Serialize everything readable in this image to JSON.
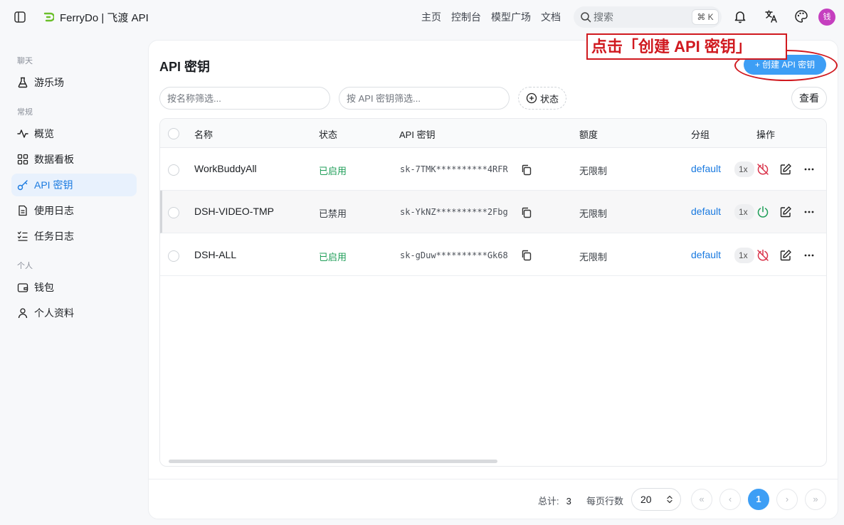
{
  "app": {
    "title": "FerryDo | 飞渡 API"
  },
  "nav": {
    "items": [
      "主页",
      "控制台",
      "模型广场",
      "文档"
    ]
  },
  "search": {
    "placeholder": "搜索",
    "shortcut": "⌘ K"
  },
  "user": {
    "avatar_text": "钱",
    "avatar_color": "#c53fbf"
  },
  "sidebar": {
    "sections": [
      {
        "label": "聊天",
        "items": [
          {
            "label": "游乐场",
            "icon": "flask-icon"
          }
        ]
      },
      {
        "label": "常规",
        "items": [
          {
            "label": "概览",
            "icon": "activity-icon"
          },
          {
            "label": "数据看板",
            "icon": "dashboard-icon"
          },
          {
            "label": "API 密钥",
            "icon": "key-icon",
            "active": true
          },
          {
            "label": "使用日志",
            "icon": "document-icon"
          },
          {
            "label": "任务日志",
            "icon": "list-icon"
          }
        ]
      },
      {
        "label": "个人",
        "items": [
          {
            "label": "钱包",
            "icon": "wallet-icon"
          },
          {
            "label": "个人资料",
            "icon": "user-icon"
          }
        ]
      }
    ]
  },
  "page": {
    "title": "API 密钥",
    "create_button": "+ 创建 API 密钥",
    "annotation": "点击「创建 API 密钥」",
    "filters": {
      "name_placeholder": "按名称筛选...",
      "key_placeholder": "按 API 密钥筛选...",
      "status_button": "状态",
      "view_button": "查看"
    }
  },
  "table": {
    "columns": [
      "名称",
      "状态",
      "API 密钥",
      "额度",
      "分组",
      "操作"
    ],
    "rows": [
      {
        "name": "WorkBuddyAll",
        "status": "已启用",
        "enabled": true,
        "key": "sk-7TMK**********4RFR",
        "quota": "无限制",
        "group": "default",
        "multiplier": "1x"
      },
      {
        "name": "DSH-VIDEO-TMP",
        "status": "已禁用",
        "enabled": false,
        "key": "sk-YkNZ**********2Fbg",
        "quota": "无限制",
        "group": "default",
        "multiplier": "1x"
      },
      {
        "name": "DSH-ALL",
        "status": "已启用",
        "enabled": true,
        "key": "sk-gDuw**********Gk68",
        "quota": "无限制",
        "group": "default",
        "multiplier": "1x"
      }
    ]
  },
  "pagination": {
    "total_label": "总计:",
    "total": "3",
    "per_page_label": "每页行数",
    "page_size": "20",
    "current_page": "1"
  },
  "colors": {
    "accent": "#3d9ef5",
    "enabled": "#1d9d57",
    "annotation": "#d0191f",
    "link": "#1a7ae0"
  }
}
